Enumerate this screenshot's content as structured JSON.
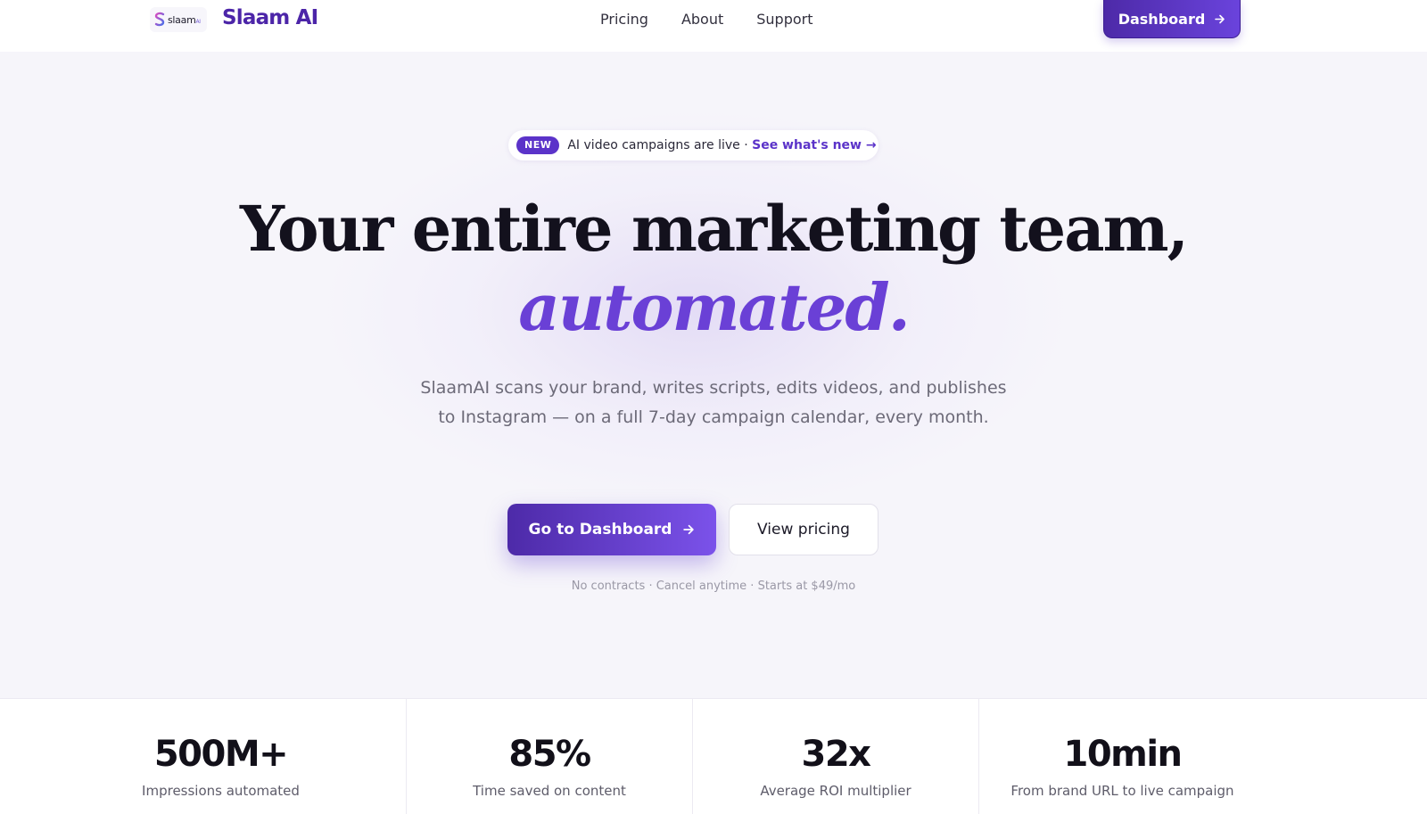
{
  "nav": {
    "logo_text": "slaam",
    "logo_suffix": "AI",
    "brand": "Slaam AI",
    "links": [
      "Pricing",
      "About",
      "Support"
    ],
    "dashboard_label": "Dashboard"
  },
  "hero": {
    "badge": "NEW",
    "announcement": "AI video campaigns are live ·",
    "announcement_link": "See what's new →",
    "headline_line1": "Your entire marketing team,",
    "headline_line2": "automated.",
    "subtext": "SlaamAI scans your brand, writes scripts, edits videos, and publishes to Instagram — on a full 7-day campaign calendar, every month.",
    "primary_cta": "Go to Dashboard",
    "secondary_cta": "View pricing",
    "fineprint": "No contracts · Cancel anytime · Starts at $49/mo"
  },
  "stats": [
    {
      "value": "500M+",
      "label": "Impressions automated"
    },
    {
      "value": "85%",
      "label": "Time saved on content"
    },
    {
      "value": "32x",
      "label": "Average ROI multiplier"
    },
    {
      "value": "10min",
      "label": "From brand URL to live campaign"
    }
  ],
  "colors": {
    "brand": "#4c25a8",
    "accent": "#6a40d6",
    "background": "#f6f5fa"
  },
  "icons": {
    "logo": "slaam-s-logo-icon",
    "arrow": "arrow-right-icon"
  }
}
